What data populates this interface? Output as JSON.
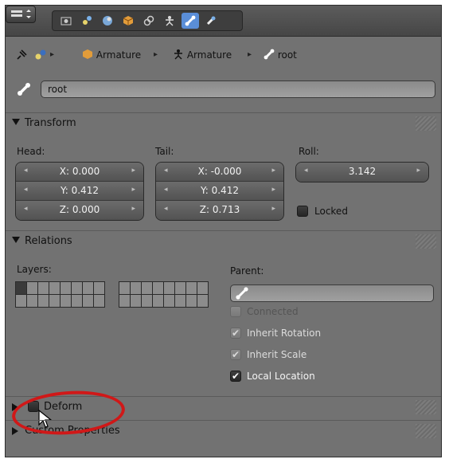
{
  "breadcrumb": {
    "armature_object": "Armature",
    "armature_data": "Armature",
    "bone": "root"
  },
  "bone_name": "root",
  "transform": {
    "title": "Transform",
    "head_label": "Head:",
    "tail_label": "Tail:",
    "roll_label": "Roll:",
    "head": [
      "X: 0.000",
      "Y: 0.412",
      "Z: 0.000"
    ],
    "tail": [
      "X: -0.000",
      "Y: 0.412",
      "Z: 0.713"
    ],
    "roll": "3.142",
    "locked_label": "Locked"
  },
  "relations": {
    "title": "Relations",
    "layers_label": "Layers:",
    "parent_label": "Parent:",
    "connected_label": "Connected",
    "inherit_rotation_label": "Inherit Rotation",
    "inherit_scale_label": "Inherit Scale",
    "local_location_label": "Local Location"
  },
  "deform": {
    "title": "Deform"
  },
  "custom_properties": {
    "title": "Custom Properties"
  },
  "colors": {
    "panel_bg": "#727272",
    "active_tab": "#5a8ed8",
    "highlight_ring": "#d01818"
  },
  "icons": [
    "editor-type-icon",
    "render-icon",
    "scene-icon",
    "world-icon",
    "object-icon",
    "constraint-icon",
    "armature-data-icon",
    "bone-icon",
    "bone-constraint-icon",
    "pin-icon",
    "bone-icon"
  ]
}
